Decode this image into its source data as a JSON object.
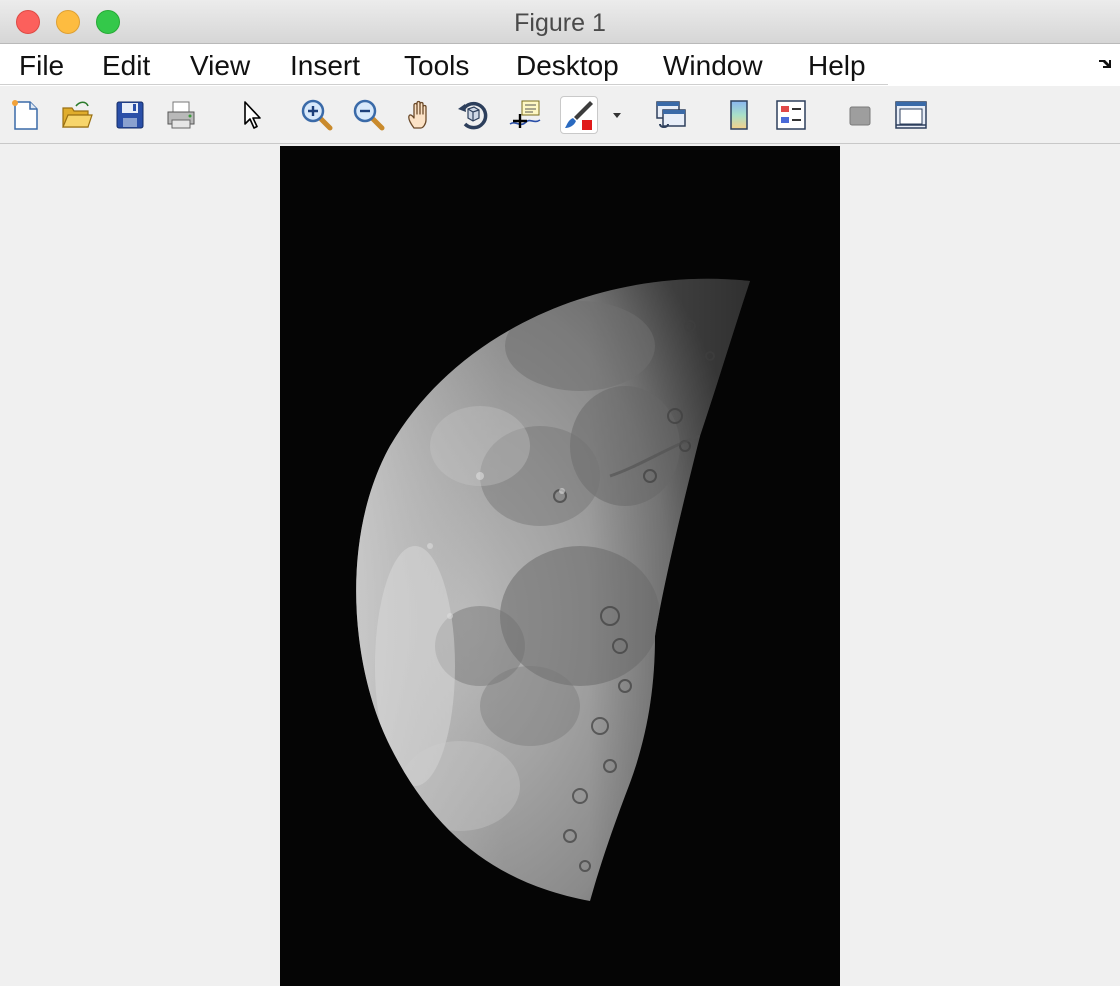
{
  "window": {
    "title": "Figure 1"
  },
  "menu": {
    "items": [
      {
        "label": "File"
      },
      {
        "label": "Edit"
      },
      {
        "label": "View"
      },
      {
        "label": "Insert"
      },
      {
        "label": "Tools"
      },
      {
        "label": "Desktop"
      },
      {
        "label": "Window"
      },
      {
        "label": "Help"
      }
    ]
  },
  "toolbar": {
    "tools": [
      {
        "icon": "new-figure-icon"
      },
      {
        "icon": "open-file-icon"
      },
      {
        "icon": "save-icon"
      },
      {
        "icon": "print-icon"
      },
      {
        "icon": "pointer-icon"
      },
      {
        "icon": "zoom-in-icon"
      },
      {
        "icon": "zoom-out-icon"
      },
      {
        "icon": "pan-hand-icon"
      },
      {
        "icon": "rotate-3d-icon"
      },
      {
        "icon": "data-cursor-icon"
      },
      {
        "icon": "brush-icon"
      },
      {
        "icon": "link-plot-icon"
      },
      {
        "icon": "colorbar-icon"
      },
      {
        "icon": "legend-icon"
      },
      {
        "icon": "hide-plot-tools-icon"
      },
      {
        "icon": "show-plot-tools-icon"
      }
    ]
  },
  "figure": {
    "image_content": "grayscale photograph of a half moon (first quarter) on black sky",
    "colors": {
      "sky": "#050505",
      "moon_highlight": "#e8e8e8",
      "moon_mid": "#9a9a9a",
      "moon_dark": "#5a5a5a"
    }
  }
}
